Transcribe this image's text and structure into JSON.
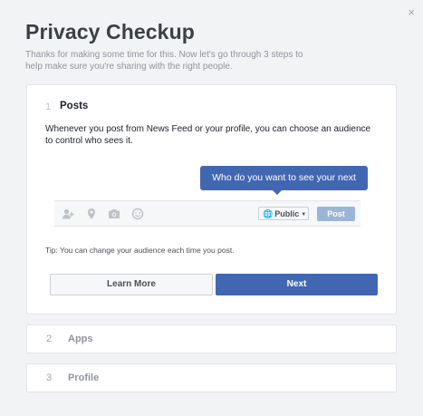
{
  "dialog": {
    "title": "Privacy Checkup",
    "subtitle": "Thanks for making some time for this. Now let's go through 3 steps to help make sure you're sharing with the right people.",
    "close_label": "×"
  },
  "steps": [
    {
      "number": "1",
      "title": "Posts",
      "description": "Whenever you post from News Feed or your profile, you can choose an audience to control who sees it.",
      "tooltip": "Who do you want to see your next post?",
      "audience_label": "Public",
      "post_label": "Post",
      "tip": "Tip: You can change your audience each time you post.",
      "learn_more_label": "Learn More",
      "next_label": "Next"
    },
    {
      "number": "2",
      "title": "Apps"
    },
    {
      "number": "3",
      "title": "Profile"
    }
  ],
  "icons": {
    "close": "close-icon",
    "tag_people": "tag-people-icon",
    "location": "location-pin-icon",
    "camera": "camera-icon",
    "feeling": "smiley-icon",
    "globe": "globe-icon",
    "caret": "caret-down-icon"
  },
  "colors": {
    "background": "#f2f3f5",
    "primary": "#4267b2",
    "post_disabled": "#9cb4d8",
    "title_text": "#3b3f46",
    "muted_text": "#90949c"
  }
}
